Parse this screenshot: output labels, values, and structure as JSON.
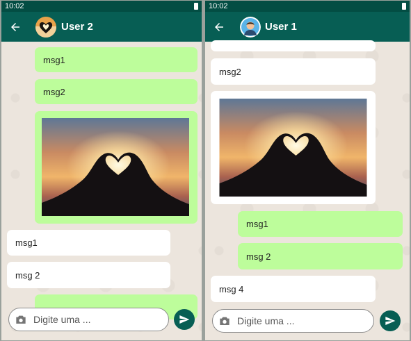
{
  "left": {
    "status_time": "10:02",
    "contact_name": "User 2",
    "messages": [
      {
        "text": "msg1",
        "side": "sent"
      },
      {
        "text": "msg2",
        "side": "sent"
      },
      {
        "type": "image",
        "side": "sent",
        "image": "heart-hands-sunset"
      },
      {
        "text": "msg1",
        "side": "received"
      },
      {
        "text": "msg 2",
        "side": "received"
      },
      {
        "text": "",
        "side": "sent"
      }
    ],
    "input_placeholder": "Digite uma ..."
  },
  "right": {
    "status_time": "10:02",
    "contact_name": "User 1",
    "messages": [
      {
        "text": "",
        "side": "received"
      },
      {
        "text": "msg2",
        "side": "received"
      },
      {
        "type": "image",
        "side": "received",
        "image": "heart-hands-sunset"
      },
      {
        "text": "msg1",
        "side": "sent"
      },
      {
        "text": "msg 2",
        "side": "sent"
      },
      {
        "text": "msg 4",
        "side": "received"
      }
    ],
    "input_placeholder": "Digite uma ..."
  },
  "colors": {
    "appbar": "#075e54",
    "statusbar": "#034d43",
    "sent_bubble": "#bdfd9b",
    "received_bubble": "#ffffff",
    "chat_background": "#ece5dd"
  },
  "icons": [
    "back-arrow-icon",
    "camera-icon",
    "send-icon",
    "battery-icon"
  ]
}
